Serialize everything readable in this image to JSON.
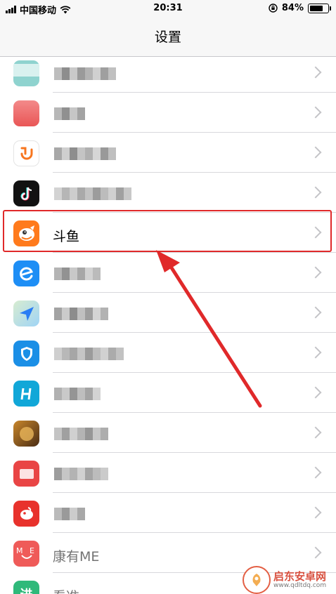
{
  "status_bar": {
    "carrier": "中国移动",
    "time": "20:31",
    "battery": "84%",
    "battery_level": 0.84
  },
  "nav": {
    "title": "设置"
  },
  "highlighted_app": {
    "label": "斗鱼"
  },
  "annotation_color": "#e0292a",
  "partial_labels": {
    "me_app": "康有ME",
    "last_app": "看准"
  },
  "watermark": {
    "title": "启东安卓网",
    "url": "www.qdltdq.com"
  }
}
